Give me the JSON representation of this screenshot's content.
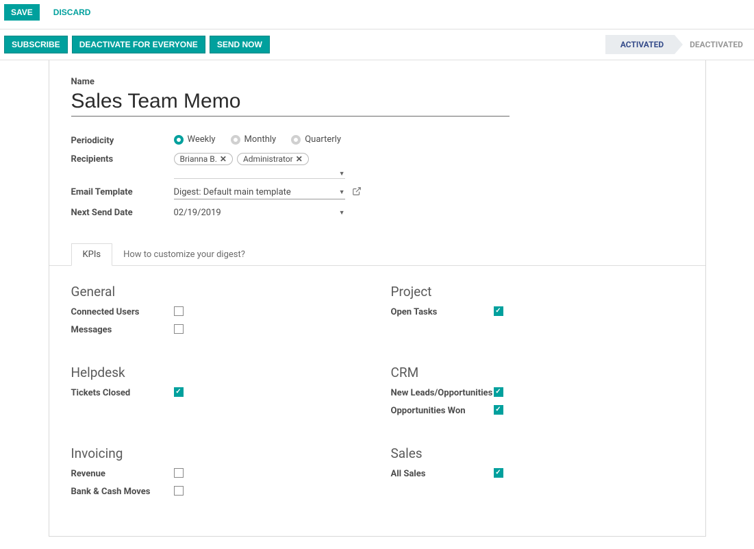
{
  "topbar": {
    "save": "Save",
    "discard": "Discard"
  },
  "actions": {
    "subscribe": "Subscribe",
    "deactivate": "Deactivate for Everyone",
    "send_now": "Send Now"
  },
  "status": {
    "activated": "Activated",
    "deactivated": "Deactivated",
    "active": "activated"
  },
  "form": {
    "name_label": "Name",
    "name_value": "Sales Team Memo",
    "periodicity_label": "Periodicity",
    "periodicity_options": {
      "weekly": "Weekly",
      "monthly": "Monthly",
      "quarterly": "Quarterly"
    },
    "periodicity_value": "weekly",
    "recipients_label": "Recipients",
    "recipients": [
      "Brianna B.",
      "Administrator"
    ],
    "email_template_label": "Email Template",
    "email_template_value": "Digest: Default main template",
    "next_send_label": "Next Send Date",
    "next_send_value": "02/19/2019"
  },
  "tabs": {
    "kpis": "KPIs",
    "howto": "How to customize your digest?"
  },
  "kpis": {
    "general": {
      "title": "General",
      "items": [
        {
          "label": "Connected Users",
          "checked": false
        },
        {
          "label": "Messages",
          "checked": false
        }
      ]
    },
    "project": {
      "title": "Project",
      "items": [
        {
          "label": "Open Tasks",
          "checked": true
        }
      ]
    },
    "helpdesk": {
      "title": "Helpdesk",
      "items": [
        {
          "label": "Tickets Closed",
          "checked": true
        }
      ]
    },
    "crm": {
      "title": "CRM",
      "items": [
        {
          "label": "New Leads/Opportunities",
          "checked": true
        },
        {
          "label": "Opportunities Won",
          "checked": true
        }
      ]
    },
    "invoicing": {
      "title": "Invoicing",
      "items": [
        {
          "label": "Revenue",
          "checked": false
        },
        {
          "label": "Bank & Cash Moves",
          "checked": false
        }
      ]
    },
    "sales": {
      "title": "Sales",
      "items": [
        {
          "label": "All Sales",
          "checked": true
        }
      ]
    }
  }
}
